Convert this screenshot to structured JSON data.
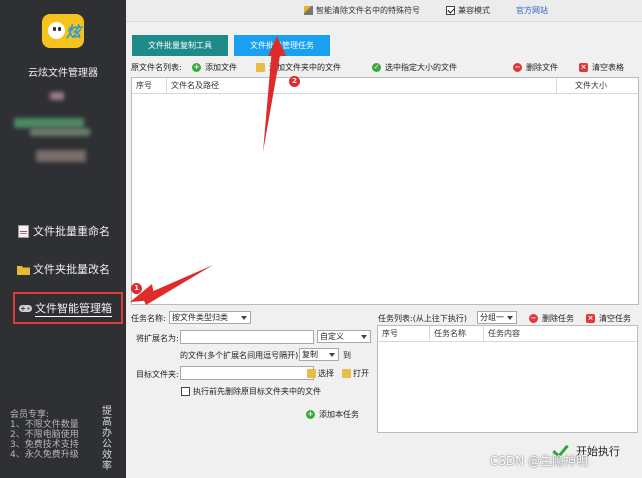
{
  "sidebar": {
    "app_title": "云炫文件管理器",
    "nav": [
      {
        "label": "文件批量重命名",
        "icon": "document-icon"
      },
      {
        "label": "文件夹批量改名",
        "icon": "folder-icon"
      },
      {
        "label": "文件智能管理箱",
        "icon": "gamepad-icon"
      }
    ],
    "promo_lines": [
      "会员专享:",
      "1、不限文件数量",
      "2、不限电脑使用",
      "3、免费技术支持",
      "4、永久免费升级"
    ],
    "promo_vertical": "提高办公效率"
  },
  "topbar": {
    "wand_label": "智能清除文件名中的特殊符号",
    "compat_label": "兼容模式",
    "compat_checked": true,
    "official_label": "官方网站"
  },
  "tabs": [
    "文件批量复制工具",
    "文件批量管理任务"
  ],
  "toolbar": {
    "file_list_label": "原文件名列表:",
    "add_file": "添加文件",
    "add_folder": "添加文件夹中的文件",
    "select_size": "选中指定大小的文件",
    "delete_file": "删除文件",
    "clear_table": "清空表格"
  },
  "file_table": {
    "columns": [
      "序号",
      "文件名及路径",
      "文件大小"
    ]
  },
  "task_form": {
    "task_name_label": "任务名称:",
    "task_name_value": "按文件类型归类",
    "ext_label": "将扩展名为:",
    "ext_mode": "自定义",
    "ext_hint": "的文件(多个扩展名间用逗号隔开)",
    "action_value": "复制",
    "to_label": "到",
    "target_label": "目标文件夹:",
    "select_label": "选择",
    "open_label": "打开",
    "pre_delete_label": "执行前先删除原目标文件夹中的文件",
    "pre_delete_checked": false,
    "add_task": "添加本任务"
  },
  "task_list": {
    "label": "任务列表:(从上往下执行)",
    "group_value": "分组一",
    "delete_task": "删除任务",
    "clear_task": "清空任务",
    "columns": [
      "序号",
      "任务名称",
      "任务内容"
    ]
  },
  "run_label": "开始执行",
  "watermark": "CSDN @生隐神明",
  "badges": [
    "1",
    "2"
  ],
  "colors": {
    "sidebar": "#2e3033",
    "tab_copy": "#1e8a8a",
    "tab_manage": "#19a0f0",
    "annotation": "#e02b2b"
  }
}
